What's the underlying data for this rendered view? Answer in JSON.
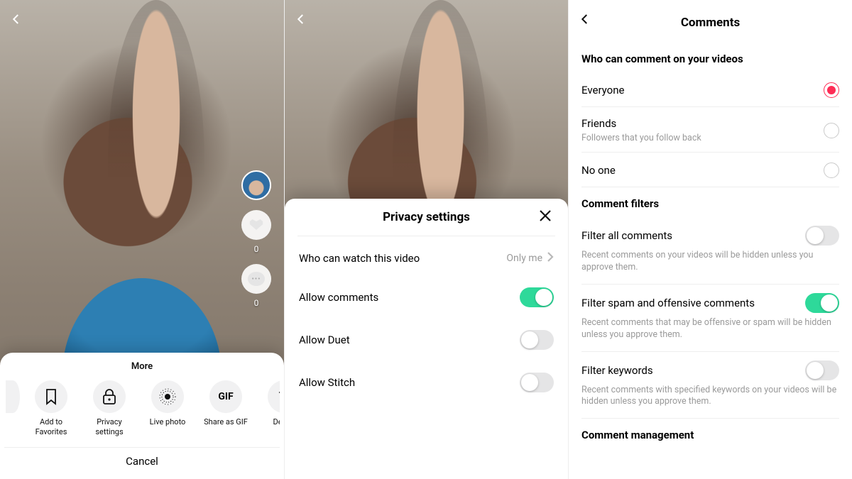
{
  "panel1": {
    "likes_count": "0",
    "comments_count": "0",
    "sheet": {
      "title": "More",
      "actions": [
        {
          "key": "clipped",
          "label": ""
        },
        {
          "key": "favorite",
          "label": "Add to Favorites"
        },
        {
          "key": "privacy",
          "label": "Privacy settings"
        },
        {
          "key": "livephoto",
          "label": "Live photo"
        },
        {
          "key": "gif",
          "label": "Share as GIF"
        },
        {
          "key": "delete",
          "label": "Delete"
        }
      ],
      "cancel": "Cancel"
    }
  },
  "panel2": {
    "title": "Privacy settings",
    "rows": {
      "watch": {
        "label": "Who can watch this video",
        "value": "Only me"
      },
      "comments": {
        "label": "Allow comments",
        "on": true
      },
      "duet": {
        "label": "Allow Duet",
        "on": false
      },
      "stitch": {
        "label": "Allow Stitch",
        "on": false
      }
    }
  },
  "panel3": {
    "title": "Comments",
    "section_who": "Who can comment on your videos",
    "options": {
      "everyone": {
        "label": "Everyone",
        "sub": "",
        "selected": true
      },
      "friends": {
        "label": "Friends",
        "sub": "Followers that you follow back",
        "selected": false
      },
      "noone": {
        "label": "No one",
        "sub": "",
        "selected": false
      }
    },
    "section_filters": "Comment filters",
    "filters": {
      "all": {
        "label": "Filter all comments",
        "sub": "Recent comments on your videos will be hidden unless you approve them.",
        "on": false
      },
      "spam": {
        "label": "Filter spam and offensive comments",
        "sub": "Recent comments that may be offensive or spam will be hidden unless you approve them.",
        "on": true
      },
      "keywords": {
        "label": "Filter keywords",
        "sub": "Recent comments with specified keywords on your videos will be hidden unless you approve them.",
        "on": false
      }
    },
    "section_mgmt": "Comment management"
  }
}
